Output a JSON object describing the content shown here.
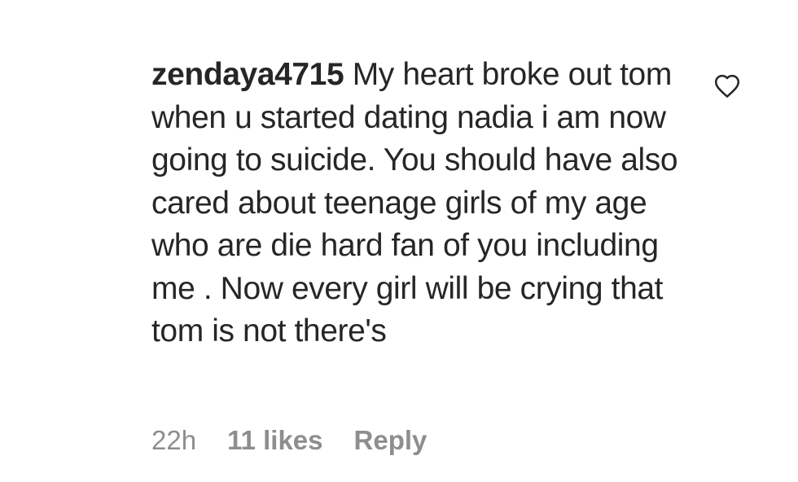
{
  "comment": {
    "username": "zendaya4715",
    "text": "My heart broke out tom when u started dating nadia i am now going to suicide. You should have also cared about teenage girls of my age who are die hard fan of you including me . Now every girl will be crying that tom is not there's"
  },
  "meta": {
    "time": "22h",
    "likes": "11 likes",
    "reply": "Reply"
  },
  "icons": {
    "like": "heart-outline-icon"
  },
  "colors": {
    "text": "#262626",
    "secondary": "#8e8e8e",
    "background": "#ffffff"
  }
}
